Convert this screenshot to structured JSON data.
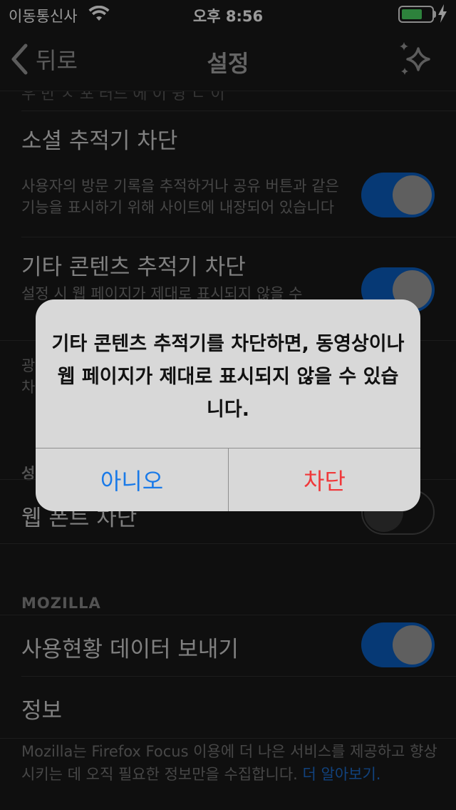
{
  "status_bar": {
    "carrier": "이동통신사",
    "time": "오후 8:56",
    "battery_color": "#4cd964"
  },
  "nav": {
    "back_label": "뒤로",
    "title": "설정",
    "right_icon": "sparkle-icon"
  },
  "settings": {
    "cut_text": "우 반 ㅈ 포 러드 에 이 뒹 ㄴ 이",
    "social": {
      "title": "소셜 추적기 차단",
      "description": "사용자의 방문 기록을 추적하거나 공유 버튼과 같은 기능을 표시하기 위해 사이트에 내장되어 있습니다",
      "enabled": true
    },
    "other_content": {
      "title": "기타 콘텐츠 추적기 차단",
      "description": "설정 시 웹 페이지가 제대로 표시되지 않을 수",
      "enabled": true
    },
    "ads_partial": {
      "line1": "광",
      "line2": "차"
    },
    "section_perf_partial": "성",
    "web_fonts": {
      "title": "웹 폰트 차단",
      "enabled": false
    },
    "mozilla_header": "MOZILLA",
    "telemetry": {
      "title": "사용현황 데이터 보내기",
      "enabled": true
    },
    "about": {
      "title": "정보"
    },
    "footer": {
      "text": "Mozilla는 Firefox Focus 이용에 더 나은 서비스를 제공하고 향상시키는 데 오직 필요한 정보만을 수집합니다. ",
      "link": "더 알아보기."
    }
  },
  "alert": {
    "message": "기타 콘텐츠 추적기를 차단하면, 동영상이나 웹 페이지가 제대로 표시되지 않을 수 있습니다.",
    "cancel_label": "아니오",
    "confirm_label": "차단",
    "cancel_color": "#1a7ae8",
    "confirm_color": "#f0383a"
  }
}
